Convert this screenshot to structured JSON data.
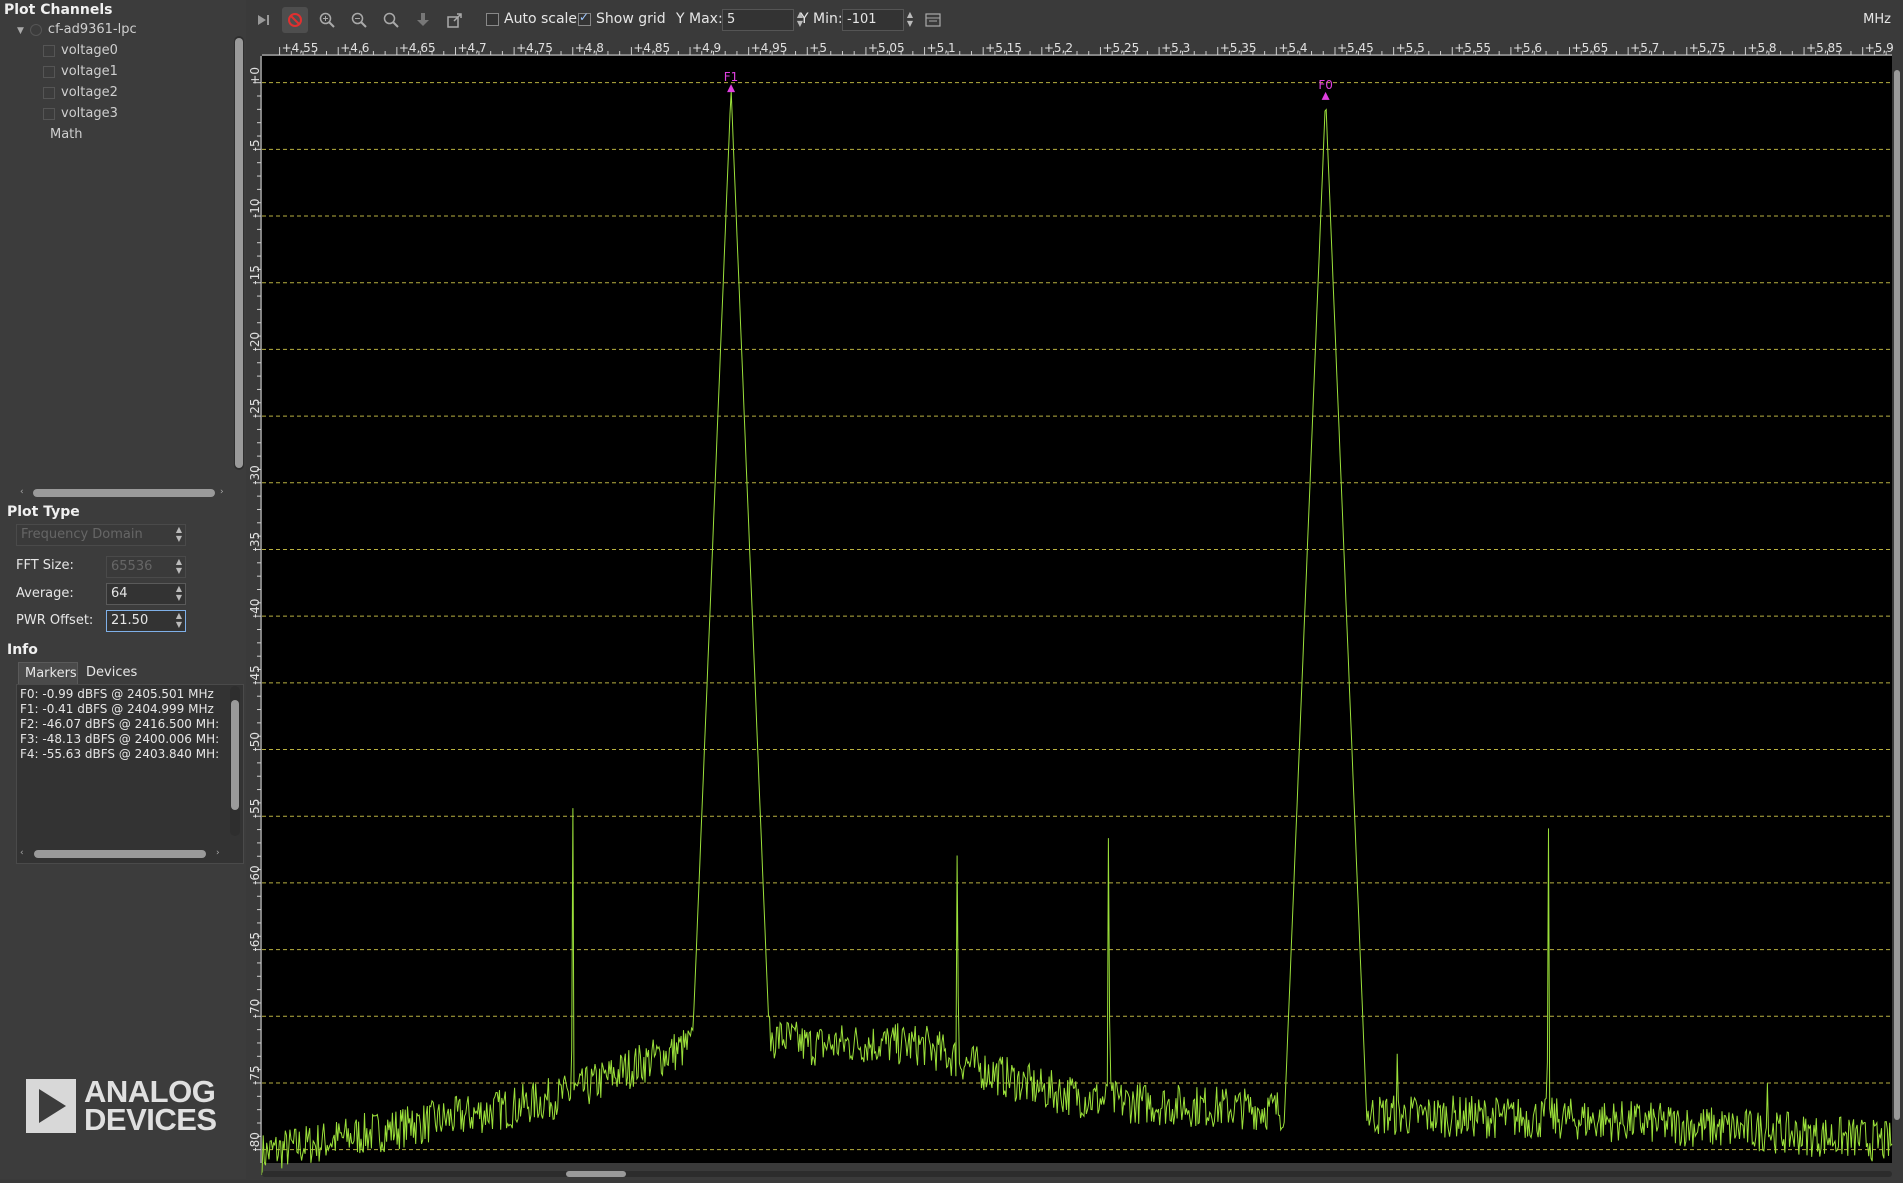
{
  "left_panel": {
    "plot_channels_title": "Plot Channels",
    "device": "cf-ad9361-lpc",
    "channels": [
      "voltage0",
      "voltage1",
      "voltage2",
      "voltage3"
    ],
    "math_label": "Math",
    "plot_type_title": "Plot Type",
    "plot_type_value": "Frequency Domain",
    "fft_size_label": "FFT Size:",
    "fft_size_value": "65536",
    "average_label": "Average:",
    "average_value": "64",
    "pwr_offset_label": "PWR Offset:",
    "pwr_offset_value": "21.50",
    "info_title": "Info",
    "tabs": [
      "Markers",
      "Devices"
    ],
    "markers": [
      "F0: -0.99 dBFS @ 2405.501 MHz",
      "F1: -0.41 dBFS @ 2404.999 MHz",
      "F2: -46.07 dBFS @ 2416.500 MH:",
      "F3: -48.13 dBFS @ 2400.006 MH:",
      "F4: -55.63 dBFS @ 2403.840 MH:"
    ],
    "logo_line1": "ANALOG",
    "logo_line2": "DEVICES"
  },
  "toolbar": {
    "auto_scale_label": "Auto scale",
    "auto_scale_checked": false,
    "show_grid_label": "Show grid",
    "show_grid_checked": true,
    "ymax_label": "Y Max:",
    "ymax_value": "5",
    "ymin_label": "Y Min:",
    "ymin_value": "-101",
    "unit_label": "MHz",
    "icons": [
      "step-forward-icon",
      "stop-icon",
      "zoom-in-icon",
      "zoom-out-icon",
      "zoom-fit-icon",
      "download-icon",
      "export-icon",
      "settings-panel-icon"
    ]
  },
  "chart_data": {
    "type": "line",
    "xlabel": "",
    "ylabel": "",
    "x_tick_labels": [
      "+4,55",
      "+4,6",
      "+4,65",
      "+4,7",
      "+4,75",
      "+4,8",
      "+4,85",
      "+4,9",
      "+4,95",
      "+5",
      "+5,05",
      "+5,1",
      "+5,15",
      "+5,2",
      "+5,25",
      "+5,3",
      "+5,35",
      "+5,4",
      "+5,45",
      "+5,5",
      "+5,55",
      "+5,6",
      "+5,65",
      "+5,7",
      "+5,75",
      "+5,8",
      "+5,85",
      "+5,9"
    ],
    "x_ticks": [
      4.55,
      4.6,
      4.65,
      4.7,
      4.75,
      4.8,
      4.85,
      4.9,
      4.95,
      5.0,
      5.05,
      5.1,
      5.15,
      5.2,
      5.25,
      5.3,
      5.35,
      5.4,
      5.45,
      5.5,
      5.55,
      5.6,
      5.65,
      5.7,
      5.75,
      5.8,
      5.85,
      5.9
    ],
    "y_tick_labels": [
      "+0",
      "-5",
      "-10",
      "-15",
      "-20",
      "-25",
      "-30",
      "-35",
      "-40",
      "-45",
      "-50",
      "-55",
      "-60",
      "-65",
      "-70",
      "-75",
      "-80"
    ],
    "y_ticks": [
      0,
      -5,
      -10,
      -15,
      -20,
      -25,
      -30,
      -35,
      -40,
      -45,
      -50,
      -55,
      -60,
      -65,
      -70,
      -75,
      -80
    ],
    "xlim": [
      4.535,
      5.925
    ],
    "ylim": [
      -81,
      2
    ],
    "grid": true,
    "line_color": "#9be03a",
    "grid_color": "#b8b040",
    "marker_color": "#e040e0",
    "noise_floor": [
      [
        4.535,
        -80.3
      ],
      [
        4.55,
        -80.0
      ],
      [
        4.6,
        -79.2
      ],
      [
        4.65,
        -78.4
      ],
      [
        4.7,
        -77.6
      ],
      [
        4.75,
        -76.8
      ],
      [
        4.8,
        -75.8
      ],
      [
        4.85,
        -73.8
      ],
      [
        4.9,
        -72.2
      ],
      [
        4.95,
        -71.8
      ],
      [
        4.98,
        -71.6
      ],
      [
        5.0,
        -72.2
      ],
      [
        5.05,
        -72.0
      ],
      [
        5.1,
        -72.2
      ],
      [
        5.15,
        -74.0
      ],
      [
        5.2,
        -75.5
      ],
      [
        5.25,
        -76.3
      ],
      [
        5.3,
        -76.6
      ],
      [
        5.35,
        -76.8
      ],
      [
        5.4,
        -77.0
      ],
      [
        5.45,
        -77.3
      ],
      [
        5.5,
        -77.4
      ],
      [
        5.55,
        -77.5
      ],
      [
        5.6,
        -77.6
      ],
      [
        5.65,
        -77.7
      ],
      [
        5.7,
        -77.9
      ],
      [
        5.75,
        -78.2
      ],
      [
        5.8,
        -78.5
      ],
      [
        5.85,
        -78.9
      ],
      [
        5.9,
        -79.2
      ],
      [
        5.925,
        -79.5
      ]
    ],
    "spurs": [
      [
        4.608,
        -69.5
      ],
      [
        4.663,
        -75.3
      ],
      [
        4.8,
        -52.3
      ],
      [
        4.935,
        -0.41
      ],
      [
        5.08,
        -70.5
      ],
      [
        5.128,
        -52.0
      ],
      [
        5.257,
        -52.3
      ],
      [
        5.318,
        -69.3
      ],
      [
        5.442,
        -0.99
      ],
      [
        5.493,
        -74.0
      ],
      [
        5.503,
        -72.0
      ],
      [
        5.555,
        -75.8
      ],
      [
        5.58,
        -69.0
      ],
      [
        5.632,
        -53.5
      ],
      [
        5.819,
        -69.7
      ]
    ],
    "markers": [
      {
        "label": "F1",
        "x": 4.935,
        "y": -0.41
      },
      {
        "label": "F0",
        "x": 5.442,
        "y": -0.99
      }
    ]
  }
}
